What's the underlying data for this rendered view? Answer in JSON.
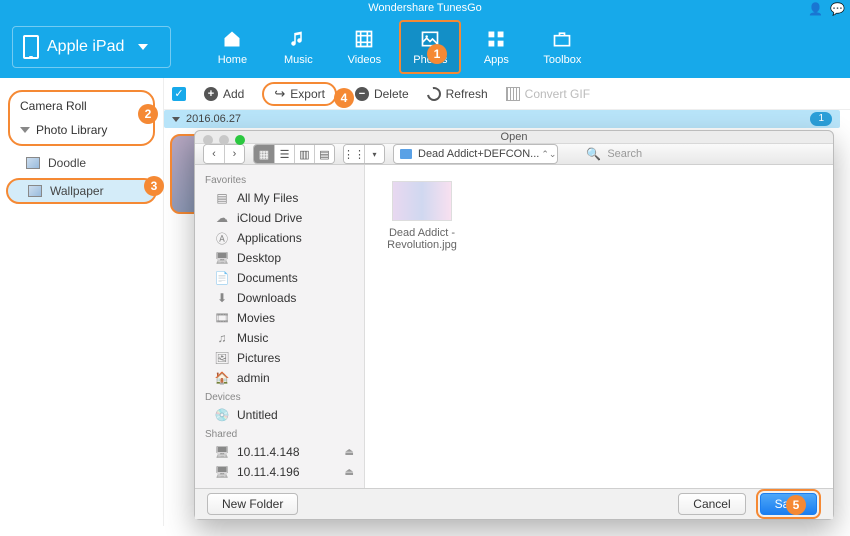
{
  "window": {
    "title": "Wondershare TunesGo"
  },
  "device": {
    "name": "Apple iPad"
  },
  "nav": {
    "home": "Home",
    "music": "Music",
    "videos": "Videos",
    "photos": "Photos",
    "apps": "Apps",
    "toolbox": "Toolbox",
    "active": "photos"
  },
  "toolbar": {
    "add": "Add",
    "export": "Export",
    "delete": "Delete",
    "refresh": "Refresh",
    "convert_gif": "Convert GIF"
  },
  "sidebar": {
    "camera_roll": "Camera Roll",
    "photo_library": "Photo Library",
    "albums": [
      {
        "label": "Doodle"
      },
      {
        "label": "Wallpaper",
        "selected": true
      }
    ]
  },
  "content": {
    "group_date": "2016.06.27",
    "group_count": "1"
  },
  "annotations": {
    "a1": "1",
    "a2": "2",
    "a3": "3",
    "a4": "4",
    "a5": "5"
  },
  "dialog": {
    "title": "Open",
    "path_label": "Dead Addict+DEFCON...",
    "search_placeholder": "Search",
    "sections": {
      "favorites": "Favorites",
      "devices": "Devices",
      "shared": "Shared"
    },
    "favorites": [
      "All My Files",
      "iCloud Drive",
      "Applications",
      "Desktop",
      "Documents",
      "Downloads",
      "Movies",
      "Music",
      "Pictures",
      "admin"
    ],
    "devices": [
      "Untitled"
    ],
    "shared": [
      "10.11.4.148",
      "10.11.4.196"
    ],
    "file_name": "Dead Addict - Revolution.jpg",
    "new_folder": "New Folder",
    "cancel": "Cancel",
    "save": "Save"
  }
}
